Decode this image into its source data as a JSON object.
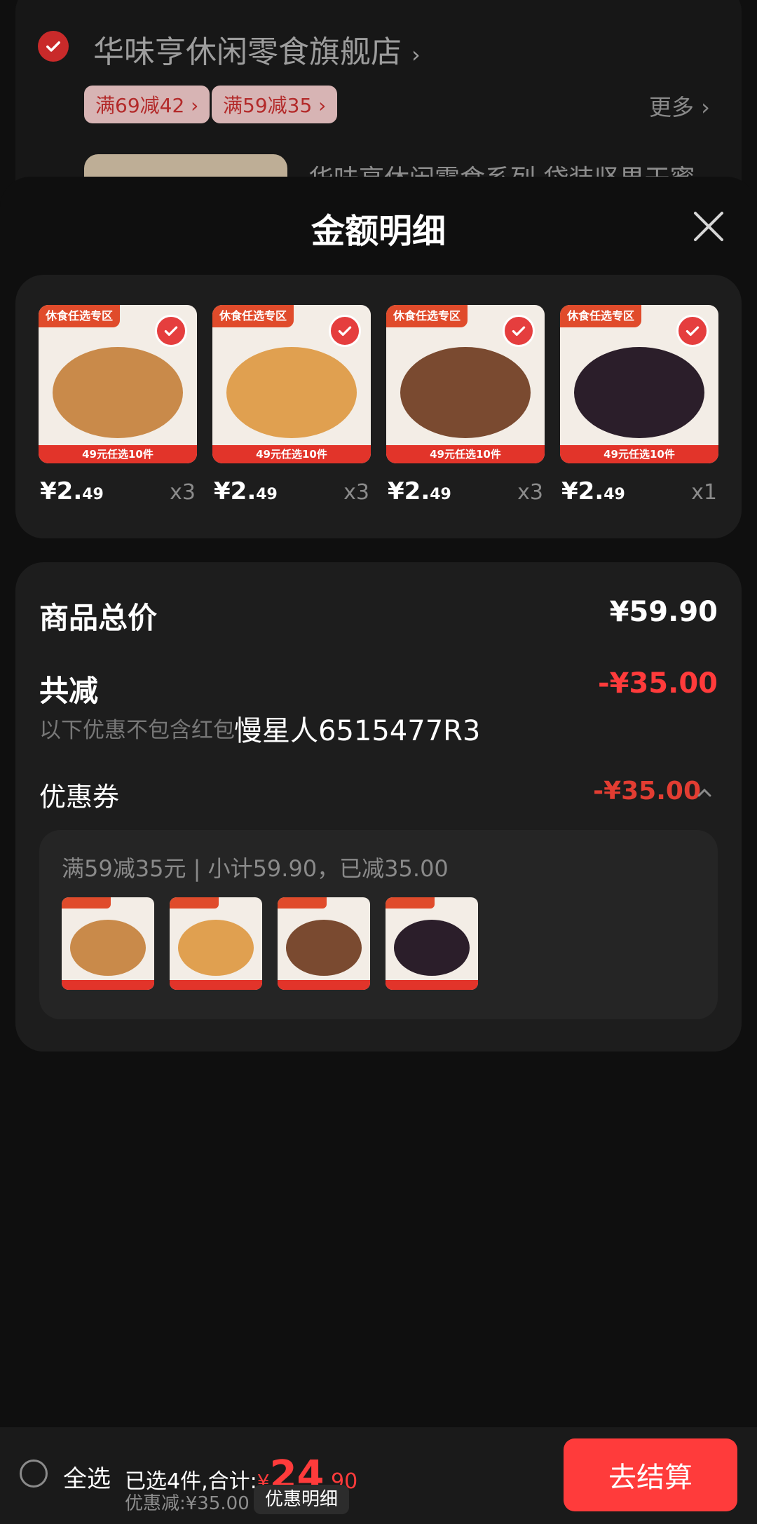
{
  "store": {
    "name": "华味亨休闲零食旗舰店",
    "chevron": "›",
    "promos": [
      "满69减42 ›",
      "满59减35 ›"
    ],
    "more": "更多 ›",
    "product_title": "华味亨休闲零食系列 袋装坚果干蜜"
  },
  "sheet": {
    "title": "金额明细"
  },
  "products": [
    {
      "tag": "休食任选专区",
      "badge": "49元任选10件",
      "price_main": "¥2.",
      "price_cents": "49",
      "qty": "x3",
      "color": "#c98a4a"
    },
    {
      "tag": "休食任选专区",
      "badge": "49元任选10件",
      "price_main": "¥2.",
      "price_cents": "49",
      "qty": "x3",
      "color": "#e0a050"
    },
    {
      "tag": "休食任选专区",
      "badge": "49元任选10件",
      "price_main": "¥2.",
      "price_cents": "49",
      "qty": "x3",
      "color": "#7a4a30"
    },
    {
      "tag": "休食任选专区",
      "badge": "49元任选10件",
      "price_main": "¥2.",
      "price_cents": "49",
      "qty": "x1",
      "color": "#2b1e2a"
    }
  ],
  "summary": {
    "total_label": "商品总价",
    "total_value": "¥59.90",
    "discount_label": "共减",
    "discount_value": "-¥35.00",
    "note": "以下优惠不包含红包",
    "watermark": "慢星人6515477R3",
    "coupon_label": "优惠券",
    "coupon_value": "-¥35.00",
    "coupon_desc": "满59减35元 | 小计59.90，已减35.00"
  },
  "footer": {
    "select_all": "全选",
    "selected_prefix": "已选4件,合计:",
    "currency": "¥",
    "total_int": "24",
    "total_dec": ".90",
    "discount_info": "优惠减:¥35.00",
    "detail_button": "优惠明细",
    "checkout_button": "去结算"
  },
  "colors": {
    "accent_red": "#ff3b3b",
    "discount_red": "#e23d32",
    "panel": "#1d1d1d"
  }
}
